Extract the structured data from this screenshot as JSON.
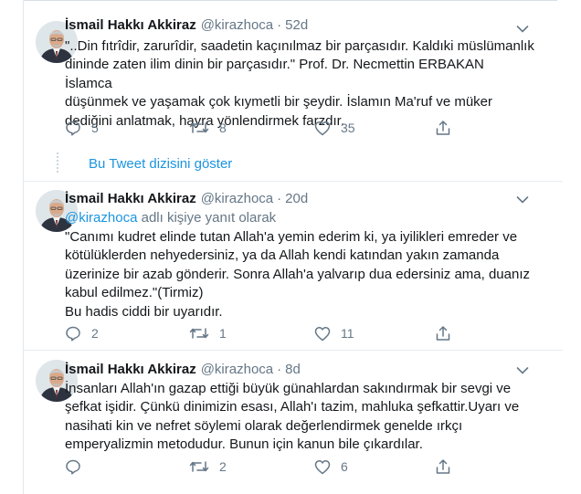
{
  "tweets": [
    {
      "name": "İsmail Hakkı Akkiraz",
      "handle": "@kirazhoca",
      "time": "52d",
      "lines": [
        "\"..Din fıtrîdir, zarurîdir, saadetin kaçınılmaz bir parçasıdır. Kaldıki müslümanlık",
        "dininde zaten ilim dinin bir parçasıdır.\" Prof. Dr. Necmettin ERBAKAN İslamca",
        "düşünmek ve yaşamak çok kıymetli bir şeydir. İslamın Ma'ruf ve müker",
        "dediğini anlatmak, hayra yönlendirmek farzdır."
      ],
      "replies": "5",
      "retweets": "8",
      "likes": "35"
    },
    {
      "name": "İsmail Hakkı Akkiraz",
      "handle": "@kirazhoca",
      "time": "20d",
      "reply_mention": "@kirazhoca",
      "reply_suffix": " adlı kişiye yanıt olarak",
      "lines": [
        "\"Canımı kudret elinde tutan Allah'a yemin ederim ki, ya iyilikleri emreder ve",
        "kötülüklerden nehyedersiniz, ya da Allah kendi katından yakın zamanda",
        "üzerinize bir azab gönderir. Sonra Allah'a yalvarıp dua edersiniz ama, duanız",
        "kabul edilmez.\"(Tirmiz)",
        "Bu hadis ciddi bir uyarıdır."
      ],
      "replies": "2",
      "retweets": "1",
      "likes": "11"
    },
    {
      "name": "İsmail Hakkı Akkiraz",
      "handle": "@kirazhoca",
      "time": "8d",
      "lines": [
        "İnsanları Allah'ın gazap ettiği büyük günahlardan sakındırmak bir sevgi ve",
        "şefkat işidir. Çünkü dinimizin esası, Allah'ı tazim, mahluka şefkattir.Uyarı ve",
        "nasihati kin ve nefret söylemi olarak değerlendirmek genelde ırkçı",
        "emperyalizmin metodudur. Bunun için kanun bile çıkardılar."
      ],
      "replies": "",
      "retweets": "2",
      "likes": "6"
    }
  ],
  "thread": {
    "show_label": "Bu Tweet dizisini göster"
  },
  "colors": {
    "link": "#1b95e0",
    "muted": "#657786",
    "text": "#14171a",
    "divider": "#e6ecf0"
  }
}
